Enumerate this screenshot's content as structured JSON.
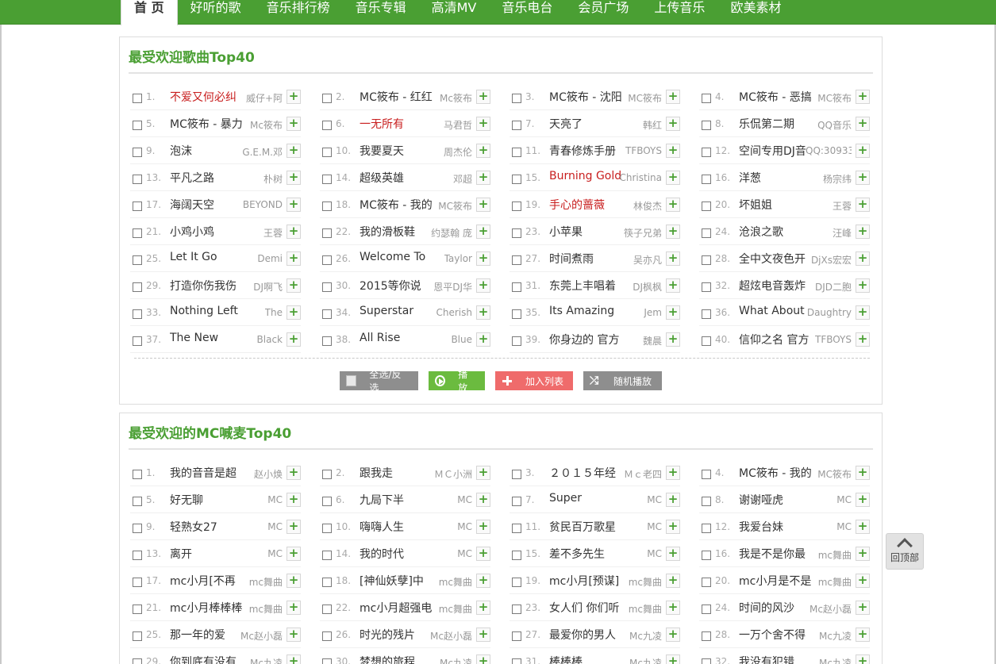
{
  "nav": {
    "items": [
      "首 页",
      "好听的歌",
      "音乐排行榜",
      "音乐专辑",
      "高清MV",
      "音乐电台",
      "会员广场",
      "上传音乐",
      "欧美素材"
    ],
    "active_index": 0
  },
  "section1": {
    "title": "最受欢迎歌曲Top40",
    "songs": [
      {
        "num": "1.",
        "title": "不爱又何必纠",
        "artist": "威仔+阿",
        "hot": true
      },
      {
        "num": "2.",
        "title": "MC筱布 - 红红",
        "artist": "Mc筱布",
        "hot": false
      },
      {
        "num": "3.",
        "title": "MC筱布 - 沈阳",
        "artist": "MC筱布",
        "hot": false
      },
      {
        "num": "4.",
        "title": "MC筱布 - 恶搞",
        "artist": "MC筱布",
        "hot": false
      },
      {
        "num": "5.",
        "title": "MC筱布 - 暴力",
        "artist": "Mc筱布",
        "hot": false
      },
      {
        "num": "6.",
        "title": "一无所有",
        "artist": "马君哲",
        "hot": true
      },
      {
        "num": "7.",
        "title": "天亮了",
        "artist": "韩红",
        "hot": false
      },
      {
        "num": "8.",
        "title": "乐侃第二期",
        "artist": "QQ音乐",
        "hot": false
      },
      {
        "num": "9.",
        "title": "泡沫",
        "artist": "G.E.M.邓",
        "hot": false
      },
      {
        "num": "10.",
        "title": "我要夏天",
        "artist": "周杰伦",
        "hot": false
      },
      {
        "num": "11.",
        "title": "青春修炼手册",
        "artist": "TFBOYS",
        "hot": false
      },
      {
        "num": "12.",
        "title": "空间专用DJ音",
        "artist": "QQ:30933",
        "hot": false
      },
      {
        "num": "13.",
        "title": "平凡之路",
        "artist": "朴树",
        "hot": false
      },
      {
        "num": "14.",
        "title": "超级英雄",
        "artist": "邓超",
        "hot": false
      },
      {
        "num": "15.",
        "title": "Burning Gold",
        "artist": "Christina",
        "hot": true
      },
      {
        "num": "16.",
        "title": "洋葱",
        "artist": "杨宗纬",
        "hot": false
      },
      {
        "num": "17.",
        "title": "海阔天空",
        "artist": "BEYOND",
        "hot": false
      },
      {
        "num": "18.",
        "title": "MC筱布 - 我的",
        "artist": "MC筱布",
        "hot": false
      },
      {
        "num": "19.",
        "title": "手心的蔷薇",
        "artist": "林俊杰",
        "hot": true
      },
      {
        "num": "20.",
        "title": "坏姐姐",
        "artist": "王蓉",
        "hot": false
      },
      {
        "num": "21.",
        "title": "小鸡小鸡",
        "artist": "王蓉",
        "hot": false
      },
      {
        "num": "22.",
        "title": "我的滑板鞋",
        "artist": "约瑟翰 庞",
        "hot": false
      },
      {
        "num": "23.",
        "title": "小苹果",
        "artist": "筷子兄弟",
        "hot": false
      },
      {
        "num": "24.",
        "title": "沧浪之歌",
        "artist": "汪峰",
        "hot": false
      },
      {
        "num": "25.",
        "title": "Let It Go",
        "artist": "Demi",
        "hot": false
      },
      {
        "num": "26.",
        "title": "Welcome To",
        "artist": "Taylor",
        "hot": false
      },
      {
        "num": "27.",
        "title": "时间煮雨",
        "artist": "吴亦凡",
        "hot": false
      },
      {
        "num": "28.",
        "title": "全中文夜色开",
        "artist": "DjXs宏宏",
        "hot": false
      },
      {
        "num": "29.",
        "title": "打造你伤我伤",
        "artist": "DJ啊飞",
        "hot": false
      },
      {
        "num": "30.",
        "title": "2015等你说",
        "artist": "恩平DJ华",
        "hot": false
      },
      {
        "num": "31.",
        "title": "东莞上丰唱着",
        "artist": "DJ枫枫",
        "hot": false
      },
      {
        "num": "32.",
        "title": "超炫电音轰炸",
        "artist": "DJD二胞",
        "hot": false
      },
      {
        "num": "33.",
        "title": "Nothing Left",
        "artist": "The",
        "hot": false
      },
      {
        "num": "34.",
        "title": "Superstar",
        "artist": "Cherish",
        "hot": false
      },
      {
        "num": "35.",
        "title": "Its Amazing",
        "artist": "Jem",
        "hot": false
      },
      {
        "num": "36.",
        "title": "What About",
        "artist": "Daughtry",
        "hot": false
      },
      {
        "num": "37.",
        "title": "The New",
        "artist": "Black",
        "hot": false
      },
      {
        "num": "38.",
        "title": "All Rise",
        "artist": "Blue",
        "hot": false
      },
      {
        "num": "39.",
        "title": "你身边的 官方",
        "artist": "魏晨",
        "hot": false
      },
      {
        "num": "40.",
        "title": "信仰之名 官方",
        "artist": "TFBOYS",
        "hot": false
      }
    ],
    "buttons": {
      "select_all": "全选/反选",
      "play": "播放",
      "add_list": "加入列表",
      "random": "随机播放"
    }
  },
  "section2": {
    "title": "最受欢迎的MC喊麦Top40",
    "songs": [
      {
        "num": "1.",
        "title": "我的音音是超",
        "artist": "赵小焕",
        "hot": false
      },
      {
        "num": "2.",
        "title": "跟我走",
        "artist": "ＭＣ小洲",
        "hot": false
      },
      {
        "num": "3.",
        "title": "２０１５年经",
        "artist": "Ｍｃ老四",
        "hot": false
      },
      {
        "num": "4.",
        "title": "MC筱布 - 我的",
        "artist": "MC筱布",
        "hot": false
      },
      {
        "num": "5.",
        "title": "好无聊",
        "artist": "MC",
        "hot": false
      },
      {
        "num": "6.",
        "title": "九局下半",
        "artist": "MC",
        "hot": false
      },
      {
        "num": "7.",
        "title": "Super",
        "artist": "MC",
        "hot": false
      },
      {
        "num": "8.",
        "title": "谢谢哑虎",
        "artist": "MC",
        "hot": false
      },
      {
        "num": "9.",
        "title": "轻熟女27",
        "artist": "MC",
        "hot": false
      },
      {
        "num": "10.",
        "title": "嗨嗨人生",
        "artist": "MC",
        "hot": false
      },
      {
        "num": "11.",
        "title": "贫民百万歌星",
        "artist": "MC",
        "hot": false
      },
      {
        "num": "12.",
        "title": "我爱台妹",
        "artist": "MC",
        "hot": false
      },
      {
        "num": "13.",
        "title": "离开",
        "artist": "MC",
        "hot": false
      },
      {
        "num": "14.",
        "title": "我的时代",
        "artist": "MC",
        "hot": false
      },
      {
        "num": "15.",
        "title": "差不多先生",
        "artist": "MC",
        "hot": false
      },
      {
        "num": "16.",
        "title": "我是不是你最",
        "artist": "mc舞曲",
        "hot": false
      },
      {
        "num": "17.",
        "title": "mc小月[不再",
        "artist": "mc舞曲",
        "hot": false
      },
      {
        "num": "18.",
        "title": "[神仙妖孽]中",
        "artist": "mc舞曲",
        "hot": false
      },
      {
        "num": "19.",
        "title": "mc小月[预谋]",
        "artist": "mc舞曲",
        "hot": false
      },
      {
        "num": "20.",
        "title": "mc小月是不是",
        "artist": "mc舞曲",
        "hot": false
      },
      {
        "num": "21.",
        "title": "mc小月棒棒棒",
        "artist": "mc舞曲",
        "hot": false
      },
      {
        "num": "22.",
        "title": "mc小月超强电",
        "artist": "mc舞曲",
        "hot": false
      },
      {
        "num": "23.",
        "title": "女人们 你们听",
        "artist": "mc舞曲",
        "hot": false
      },
      {
        "num": "24.",
        "title": "时间的风沙",
        "artist": "Mc赵小磊",
        "hot": false
      },
      {
        "num": "25.",
        "title": "那一年的爱",
        "artist": "Mc赵小磊",
        "hot": false
      },
      {
        "num": "26.",
        "title": "时光的残片",
        "artist": "Mc赵小磊",
        "hot": false
      },
      {
        "num": "27.",
        "title": "最爱你的男人",
        "artist": "Mc九凌",
        "hot": false
      },
      {
        "num": "28.",
        "title": "一万个舍不得",
        "artist": "Mc九凌",
        "hot": false
      },
      {
        "num": "29.",
        "title": "你到底有没有",
        "artist": "Mc九凌",
        "hot": false
      },
      {
        "num": "30.",
        "title": "梦想的旅程",
        "artist": "Mc九凌",
        "hot": false
      },
      {
        "num": "31.",
        "title": "棒棒棒",
        "artist": "Mc九凌",
        "hot": false
      },
      {
        "num": "32.",
        "title": "我没有犯错",
        "artist": "Mc九凌",
        "hot": false
      }
    ]
  },
  "icons": {
    "add": "plus-icon",
    "checkbox": "checkbox-icon",
    "back_to_top": "chevron-up-icon"
  },
  "add_symbol": "+",
  "back_to_top": "回顶部",
  "colors": {
    "brand_green": "#4a9f33",
    "hot_red": "#c81e1e",
    "play_green": "#6bbb3f",
    "add_red": "#ef6b6b",
    "gray_button": "#8e8e8e"
  }
}
